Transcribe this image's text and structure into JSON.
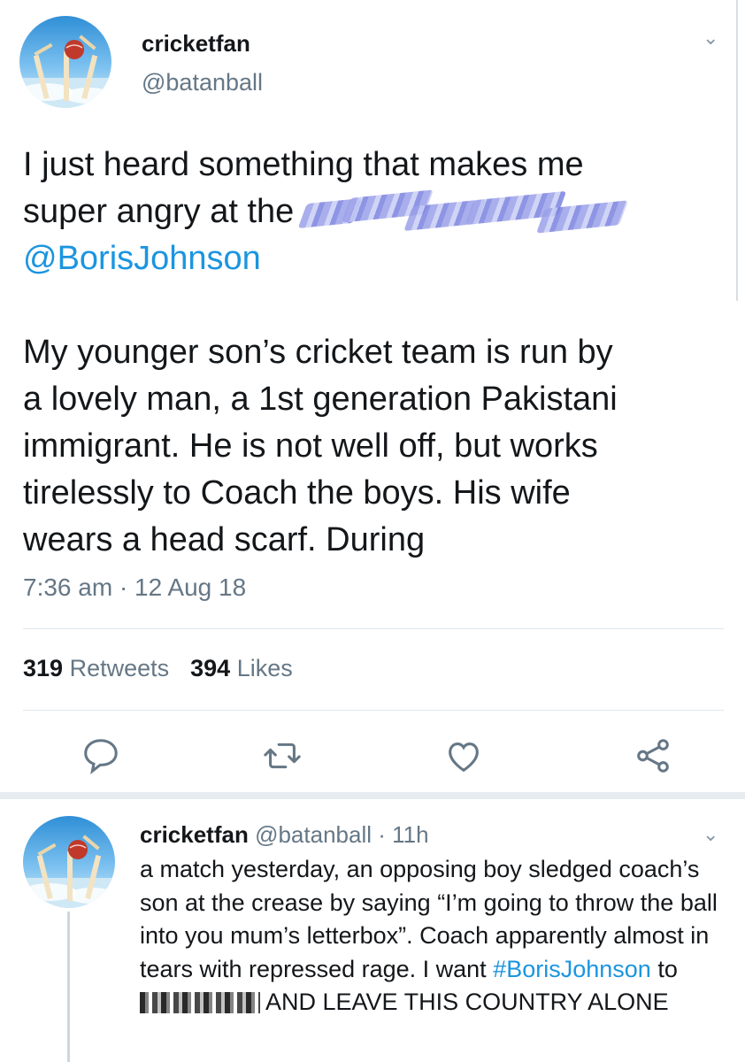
{
  "main_tweet": {
    "author": {
      "name": "cricketfan",
      "handle": "@batanball"
    },
    "text_lines": {
      "l1": "I just heard something that makes me",
      "l2": "super angry at the ",
      "mention": "@BorisJohnson",
      "p2": "My younger son’s cricket team is run by\na lovely man, a 1st generation Pakistani\nimmigrant.  He is not well off, but works\ntirelessly to Coach the boys.  His wife\nwears a head scarf. During"
    },
    "timestamp": "7:36 am · 12 Aug 18",
    "stats": {
      "retweets_count": "319",
      "retweets_label": "Retweets",
      "likes_count": "394",
      "likes_label": "Likes"
    },
    "actions": [
      "reply-icon",
      "retweet-icon",
      "like-icon",
      "share-icon"
    ]
  },
  "reply": {
    "author": {
      "name": "cricketfan",
      "handle": "@batanball",
      "time": "· 11h"
    },
    "text_a": "a match yesterday, an opposing boy sledged coach’s son at the crease by saying “I’m going to throw the ball into you mum’s letterbox”.  Coach apparently almost in tears with repressed rage.  I want ",
    "hashtag": "#BorisJohnson",
    "text_b": " to ",
    "text_c": " AND LEAVE THIS COUNTRY ALONE"
  },
  "colors": {
    "link": "#1b95e0",
    "muted": "#657786",
    "text": "#14171a",
    "divider": "#e1e8ed"
  }
}
